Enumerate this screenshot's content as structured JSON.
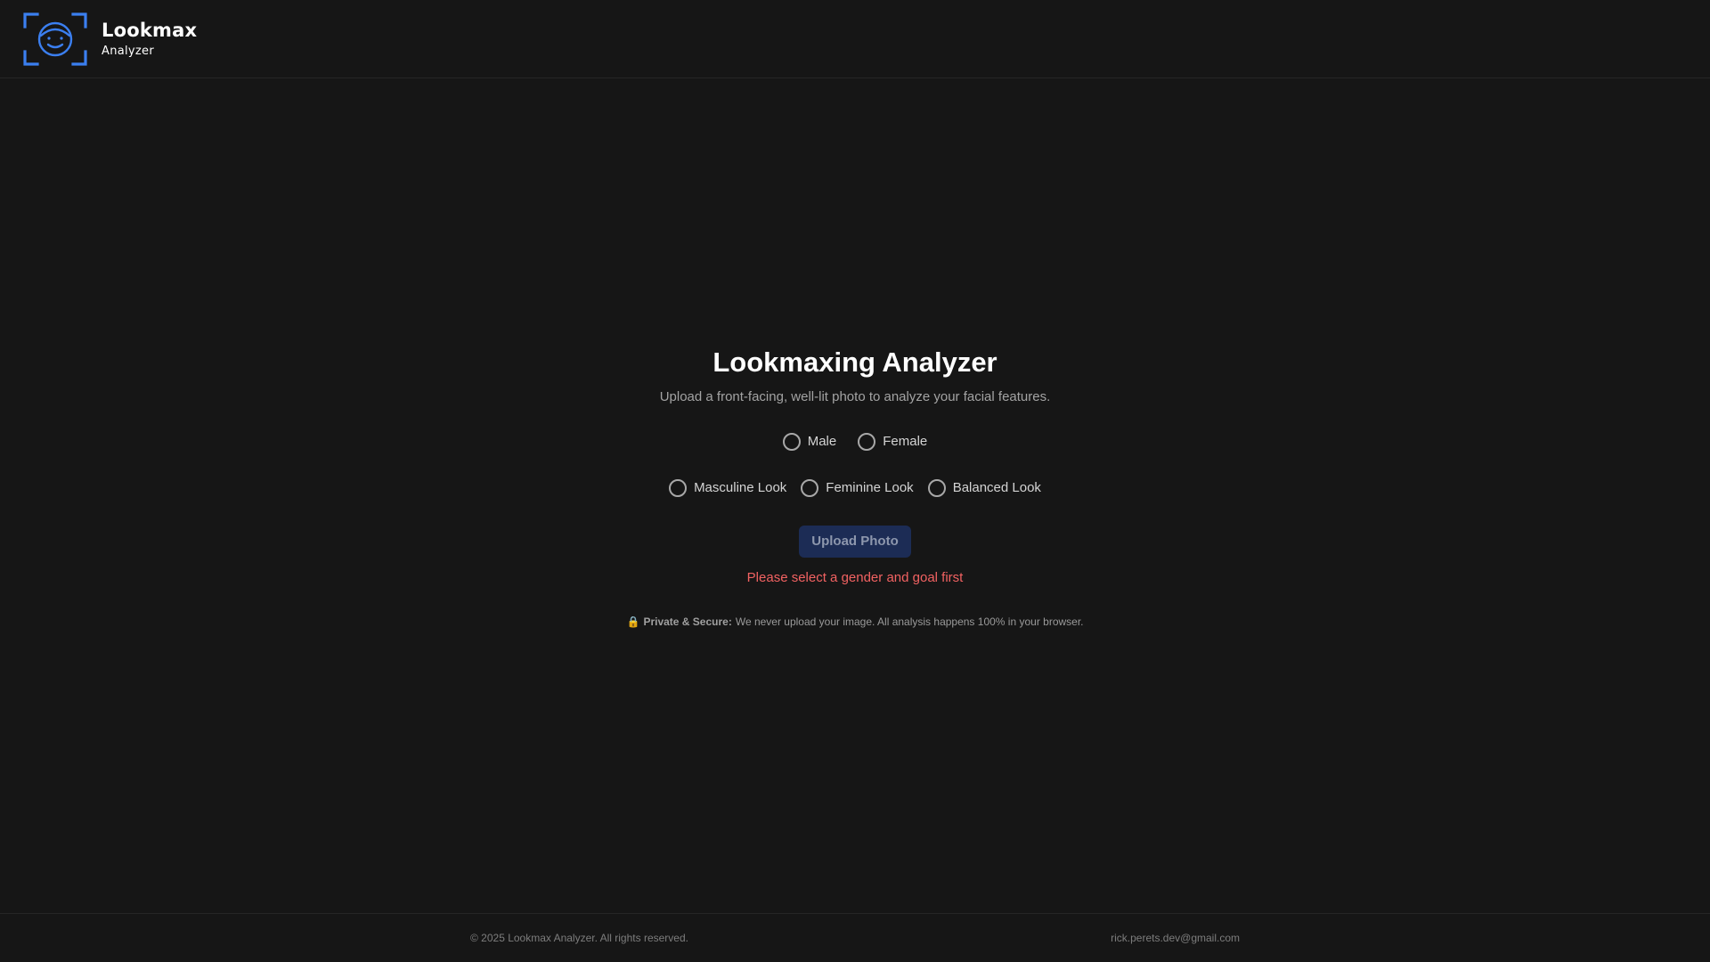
{
  "header": {
    "brand_title": "Lookmax",
    "brand_subtitle": "Analyzer",
    "logo_icon": "face-scan-icon",
    "accent_color": "#3b7ff0"
  },
  "main": {
    "title": "Lookmaxing Analyzer",
    "subtitle": "Upload a front-facing, well-lit photo to analyze your facial features.",
    "gender_options": [
      {
        "label": "Male",
        "selected": false
      },
      {
        "label": "Female",
        "selected": false
      }
    ],
    "goal_options": [
      {
        "label": "Masculine Look",
        "selected": false
      },
      {
        "label": "Feminine Look",
        "selected": false
      },
      {
        "label": "Balanced Look",
        "selected": false
      }
    ],
    "upload_button": "Upload Photo",
    "upload_disabled": true,
    "error_message": "Please select a gender and goal first",
    "error_color": "#f26262",
    "privacy": {
      "icon": "lock-icon",
      "lock_glyph": "🔒",
      "bold_label": "Private & Secure:",
      "text": " We never upload your image. All analysis happens 100% in your browser."
    }
  },
  "footer": {
    "copyright": "© 2025 Lookmax Analyzer. All rights reserved.",
    "email": "rick.perets.dev@gmail.com"
  }
}
